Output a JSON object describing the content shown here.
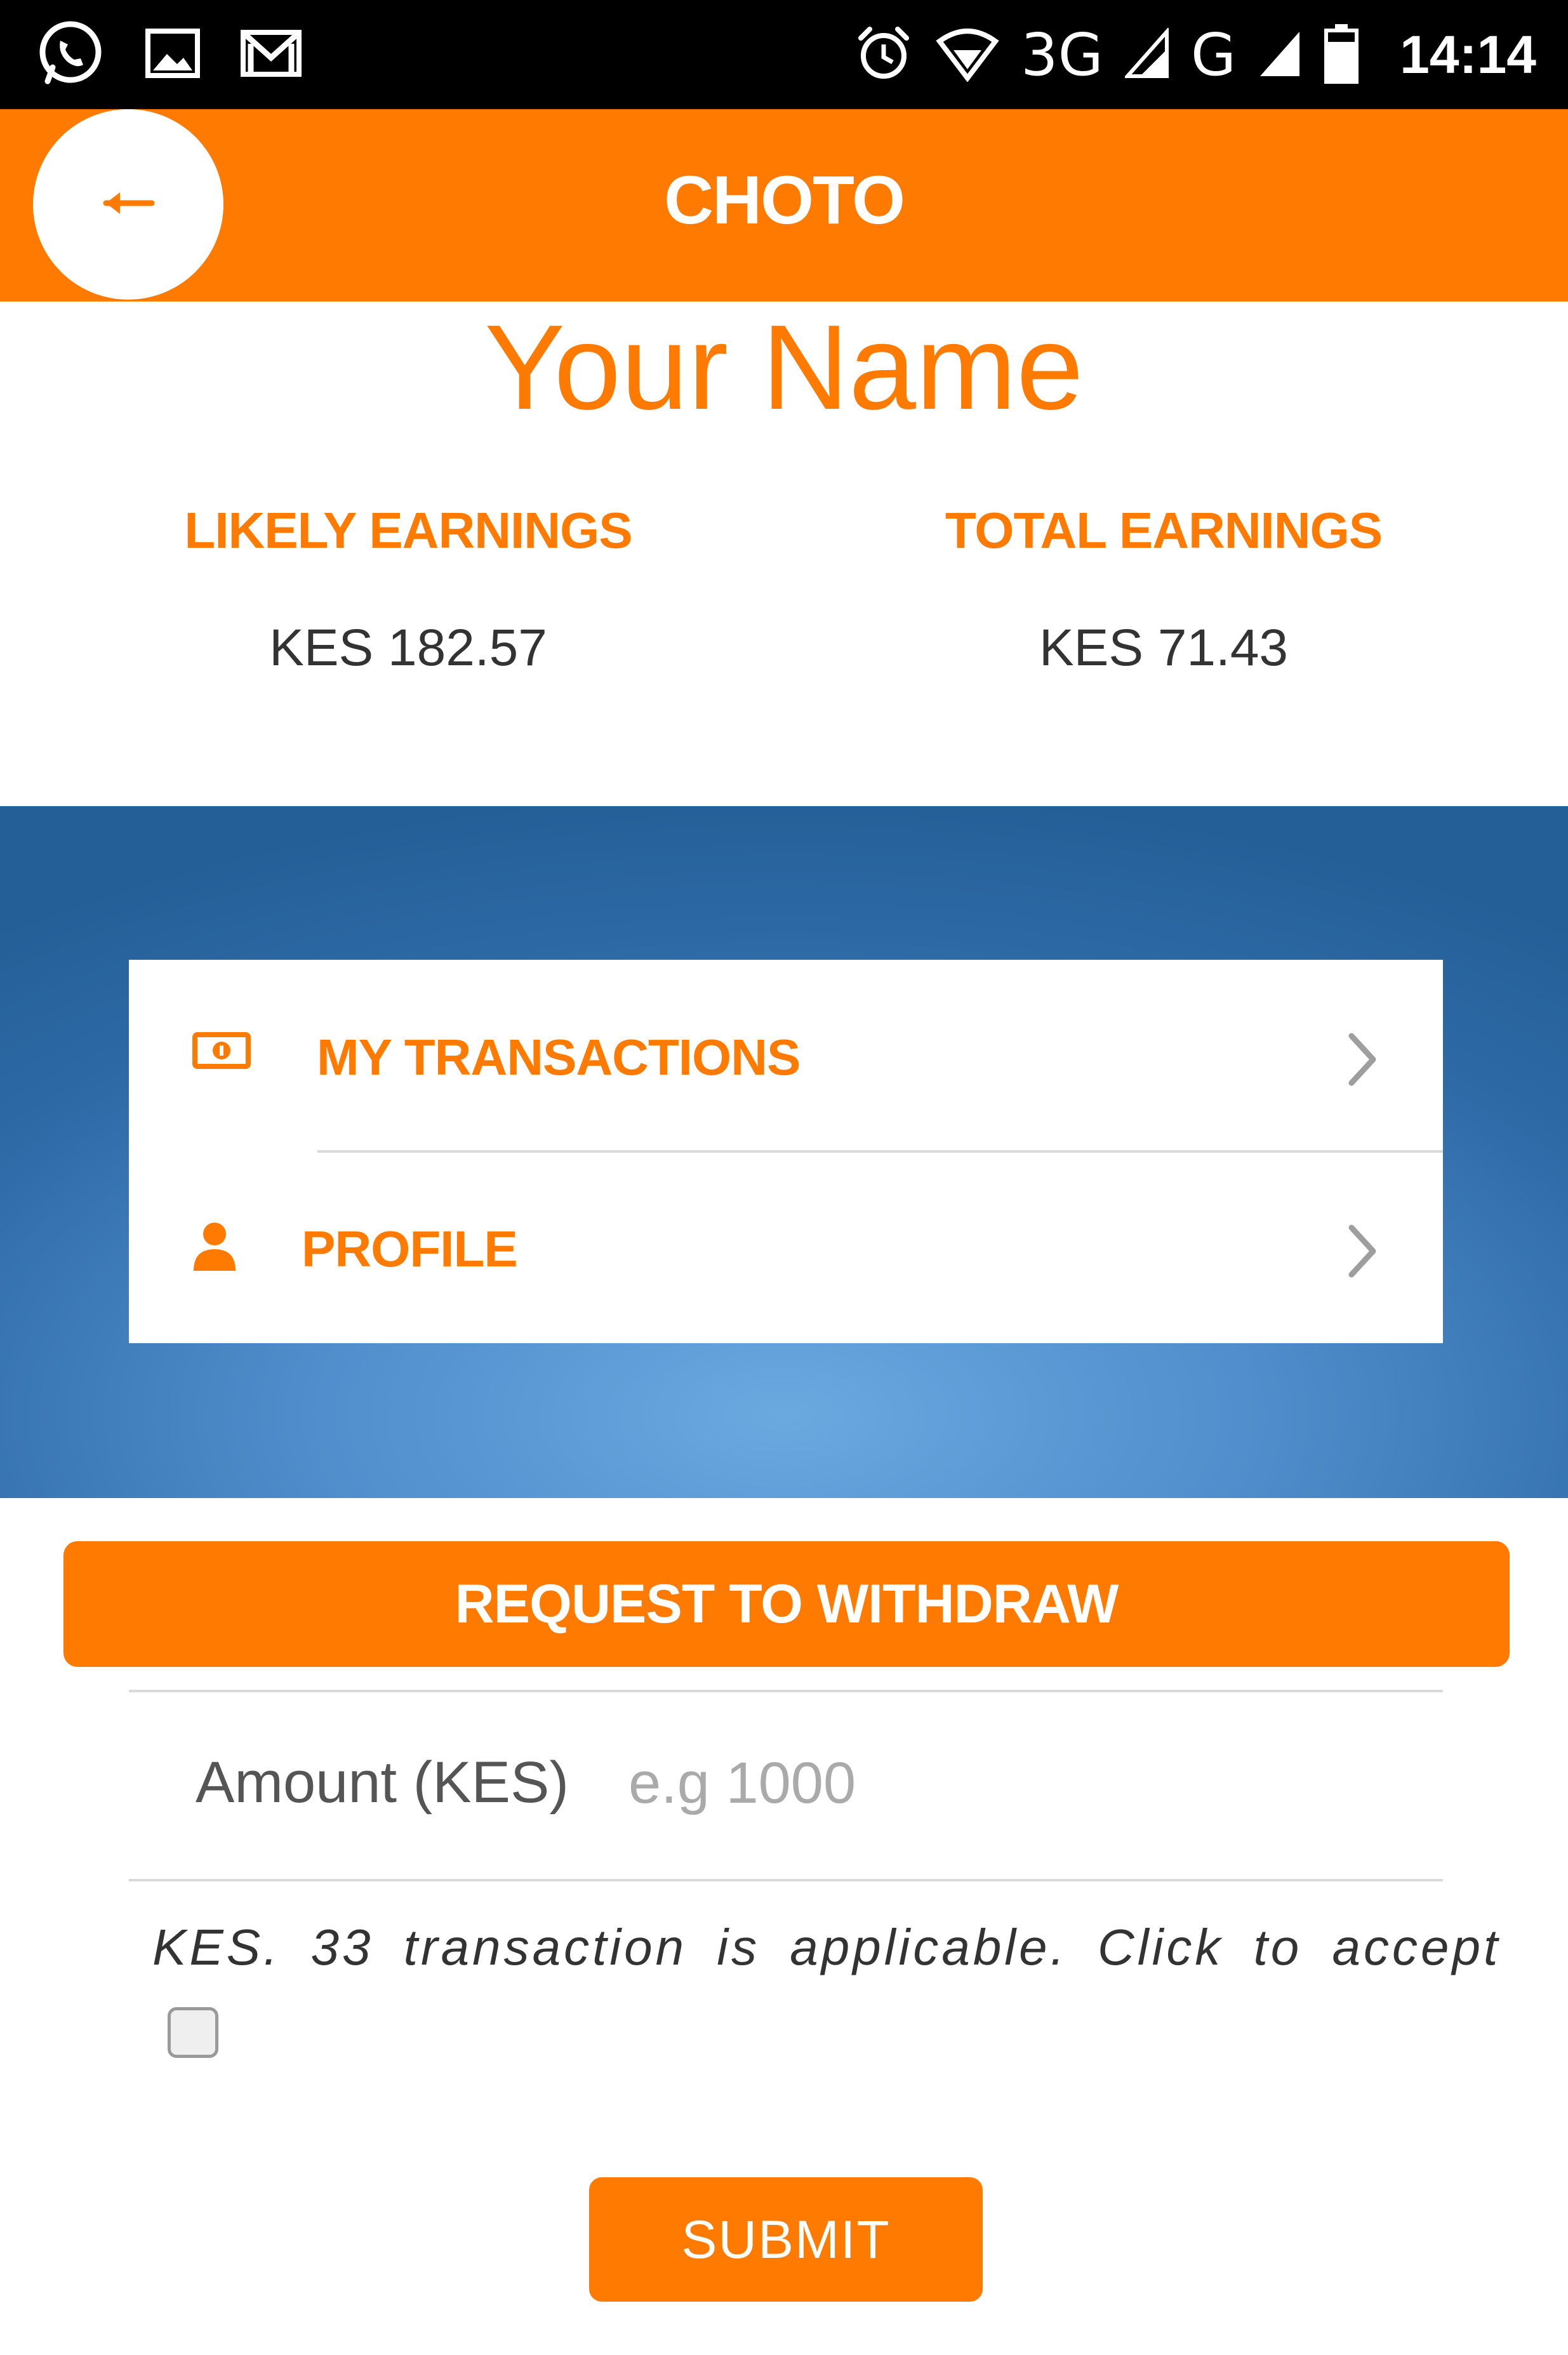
{
  "status_bar": {
    "network": "3G",
    "network2": "G",
    "time": "14:14",
    "icons": [
      "whatsapp-icon",
      "image-icon",
      "gmail-icon",
      "alarm-icon",
      "wifi-icon",
      "signal-icon",
      "signal-icon",
      "battery-icon"
    ]
  },
  "app_bar": {
    "title": "CHOTO",
    "back_icon": "back-arrow-icon"
  },
  "user": {
    "name": "Your Name"
  },
  "earnings": {
    "likely_label": "LIKELY EARNINGS",
    "likely_value": "KES 182.57",
    "total_label": "TOTAL EARNINGS",
    "total_value": "KES 71.43"
  },
  "menu": {
    "items": [
      {
        "label": "MY TRANSACTIONS",
        "icon": "money-icon"
      },
      {
        "label": "PROFILE",
        "icon": "user-icon"
      }
    ]
  },
  "withdraw": {
    "button_label": "REQUEST TO WITHDRAW",
    "amount_label": "Amount (KES)",
    "amount_placeholder": "e.g 1000",
    "fee_text": "KES. 33 transaction is applicable. Click to accept",
    "accept_checked": false,
    "submit_label": "SUBMIT"
  },
  "colors": {
    "accent": "#ff7a00",
    "panel_blue": "#2d6aa6",
    "panel_blue_light": "#6aa9e0"
  }
}
